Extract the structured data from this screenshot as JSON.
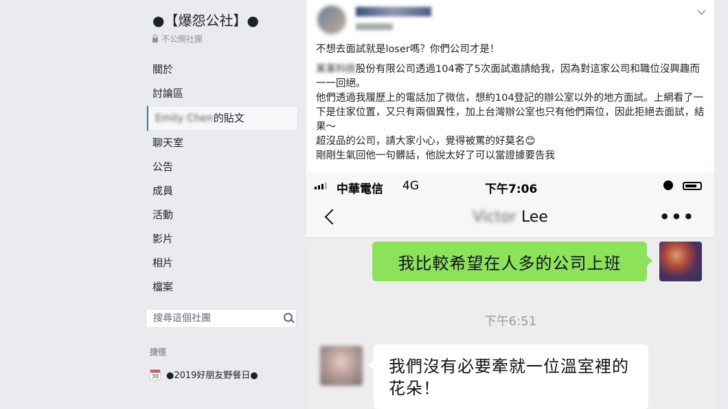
{
  "sidebar": {
    "group_name": "●【爆怨公社】●",
    "privacy": "不公開社團",
    "nav": [
      {
        "label": "關於"
      },
      {
        "label": "討論區"
      },
      {
        "label_blurred": "Emily Chen",
        "label_suffix": "的貼文"
      },
      {
        "label": "聊天室"
      },
      {
        "label": "公告"
      },
      {
        "label": "成員"
      },
      {
        "label": "活動"
      },
      {
        "label": "影片"
      },
      {
        "label": "相片"
      },
      {
        "label": "檔案"
      }
    ],
    "search_placeholder": "搜尋這個社團",
    "shortcuts_heading": "捷徑",
    "shortcut": {
      "icon": "calendar-icon",
      "day": "30",
      "label": "●2019好朋友野餐日●"
    }
  },
  "post": {
    "headline": "不想去面試就是loser嗎？你們公司才是！",
    "redacted_company": "某某科技",
    "body_1": "股份有限公司透過104寄了5次面試邀請給我，因為對這家公司和職位沒興趣而一一回絕。",
    "body_2": "他們透過我履歷上的電話加了微信，想約104登記的辦公室以外的地方面試。上網看了一下是住家位置，又只有兩個異性，加上台灣辦公室也只有他們兩位，因此拒絕去面試，結果～",
    "body_3": "超沒品的公司，請大家小心，覺得被罵的好莫名😊",
    "body_4": "剛剛生氣回他一句髒話，他說太好了可以當證據要告我"
  },
  "phone": {
    "carrier": "中華電信",
    "network": "4G",
    "time": "下午7:06",
    "contact_blurred": "Victor",
    "contact_last": "Lee",
    "more": "•••",
    "msg_out": "我比較希望在人多的公司上班",
    "timestamp": "下午6:51",
    "msg_in": "我們沒有必要牽就一位溫室裡的花朵！"
  },
  "colors": {
    "accent": "#4267b2",
    "bubble_green": "#8ce35a"
  }
}
